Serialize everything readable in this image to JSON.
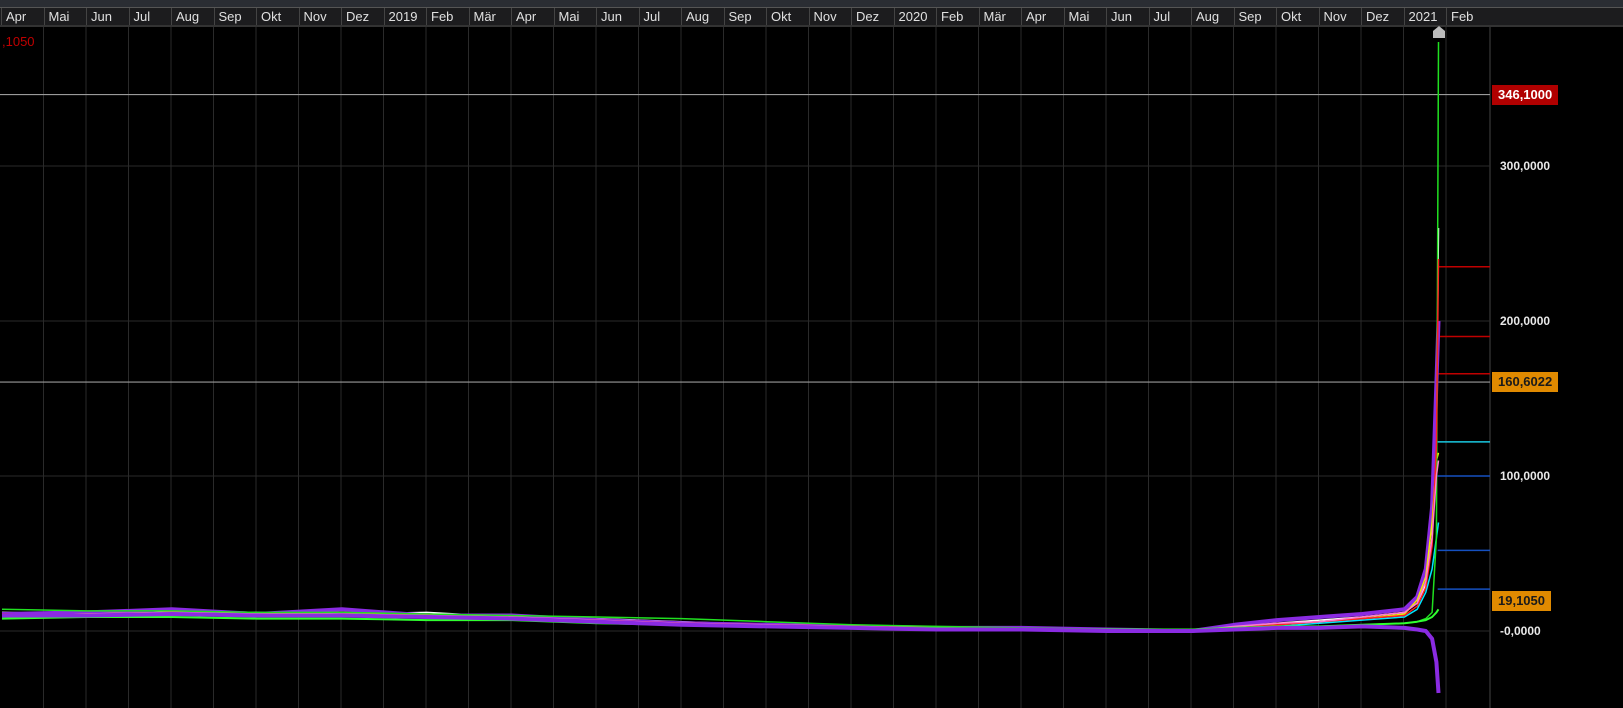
{
  "header": {
    "months": [
      "Apr",
      "Mai",
      "Jun",
      "Jul",
      "Aug",
      "Sep",
      "Okt",
      "Nov",
      "Dez",
      "2019",
      "Feb",
      "Mär",
      "Apr",
      "Mai",
      "Jun",
      "Jul",
      "Aug",
      "Sep",
      "Okt",
      "Nov",
      "Dez",
      "2020",
      "Feb",
      "Mär",
      "Apr",
      "Mai",
      "Jun",
      "Jul",
      "Aug",
      "Sep",
      "Okt",
      "Nov",
      "Dez",
      "2021",
      "Feb"
    ]
  },
  "corner_value": ",1050",
  "chart_data": {
    "type": "line",
    "title": "",
    "x_unit": "month index from Apr 2018",
    "xlim": [
      0,
      35
    ],
    "ylim": [
      -30,
      390
    ],
    "y_ticks": [
      {
        "v": 0,
        "label": "-0,0000"
      },
      {
        "v": 100,
        "label": "100,0000"
      },
      {
        "v": 200,
        "label": "200,0000"
      },
      {
        "v": 300,
        "label": "300,0000"
      }
    ],
    "price_tags": [
      {
        "v": 346.1,
        "label": "346,1000",
        "bg": "#b00000",
        "fg": "#ffffff"
      },
      {
        "v": 160.6022,
        "label": "160,6022",
        "bg": "#e08a00",
        "fg": "#1a1a1a"
      },
      {
        "v": 19.105,
        "label": "19,1050",
        "bg": "#e08a00",
        "fg": "#1a1a1a"
      }
    ],
    "hlines": [
      {
        "v": 346.1,
        "color": "#9a9a9a"
      },
      {
        "v": 160.6,
        "color": "#9a9a9a"
      }
    ],
    "level_marks": [
      {
        "v": 235,
        "color": "#c00000"
      },
      {
        "v": 190,
        "color": "#c00000"
      },
      {
        "v": 166,
        "color": "#c00000"
      },
      {
        "v": 122,
        "color": "#19c8e0"
      },
      {
        "v": 100,
        "color": "#1550c0"
      },
      {
        "v": 52,
        "color": "#1550c0"
      },
      {
        "v": 27,
        "color": "#1550c0"
      }
    ],
    "x": [
      0,
      2,
      4,
      6,
      8,
      10,
      12,
      14,
      16,
      18,
      20,
      22,
      24,
      26,
      28,
      29,
      30,
      31,
      32,
      33,
      33.3,
      33.5,
      33.65,
      33.75,
      33.8
    ],
    "series": [
      {
        "name": "white",
        "color": "#ffffff",
        "width": 1.5,
        "values": [
          12,
          11,
          13,
          12,
          11,
          12,
          9,
          8,
          6,
          4,
          3,
          2,
          1,
          1,
          0,
          3,
          5,
          7,
          9,
          12,
          18,
          30,
          60,
          130,
          260
        ]
      },
      {
        "name": "purple",
        "color": "#8a2be2",
        "width": 4,
        "values": [
          11,
          12,
          14,
          11,
          14,
          10,
          10,
          7,
          5,
          4,
          3,
          2,
          2,
          1,
          0,
          4,
          7,
          9,
          11,
          14,
          22,
          40,
          80,
          160,
          200
        ]
      },
      {
        "name": "yellow",
        "color": "#f0f000",
        "width": 1.5,
        "values": [
          10,
          11,
          12,
          11,
          12,
          10,
          9,
          6,
          5,
          3,
          2,
          2,
          1,
          0,
          0,
          2,
          4,
          6,
          8,
          11,
          20,
          35,
          70,
          110,
          115
        ]
      },
      {
        "name": "cyan",
        "color": "#00e5ff",
        "width": 1.5,
        "values": [
          9,
          10,
          11,
          10,
          11,
          9,
          8,
          6,
          4,
          3,
          2,
          1,
          1,
          0,
          0,
          2,
          3,
          5,
          7,
          9,
          14,
          25,
          40,
          60,
          70
        ]
      },
      {
        "name": "green",
        "color": "#20e020",
        "width": 1.5,
        "values": [
          14,
          13,
          13,
          12,
          12,
          11,
          10,
          9,
          8,
          6,
          4,
          3,
          2,
          1,
          1,
          1,
          2,
          3,
          4,
          5,
          6,
          8,
          12,
          60,
          380
        ]
      },
      {
        "name": "red",
        "color": "#ff2020",
        "width": 1.5,
        "values": [
          11,
          10,
          12,
          10,
          11,
          10,
          8,
          7,
          5,
          4,
          3,
          2,
          1,
          1,
          0,
          2,
          4,
          6,
          8,
          10,
          16,
          28,
          55,
          120,
          240
        ]
      },
      {
        "name": "pink",
        "color": "#ff7ad0",
        "width": 1.5,
        "values": [
          10,
          11,
          12,
          11,
          11,
          10,
          9,
          7,
          5,
          4,
          3,
          2,
          1,
          1,
          0,
          3,
          5,
          6,
          9,
          12,
          18,
          32,
          60,
          100,
          110
        ]
      },
      {
        "name": "green2",
        "color": "#30ff30",
        "width": 2,
        "values": [
          8,
          9,
          9,
          8,
          8,
          7,
          7,
          5,
          4,
          3,
          2,
          2,
          1,
          1,
          1,
          2,
          3,
          3,
          4,
          5,
          6,
          7,
          9,
          12,
          14
        ]
      },
      {
        "name": "purple-down",
        "color": "#8a2be2",
        "width": 4,
        "values": [
          10,
          10,
          11,
          10,
          10,
          9,
          8,
          6,
          4,
          3,
          2,
          1,
          1,
          0,
          0,
          1,
          2,
          2,
          3,
          2,
          1,
          0,
          -5,
          -20,
          -40
        ]
      }
    ]
  }
}
